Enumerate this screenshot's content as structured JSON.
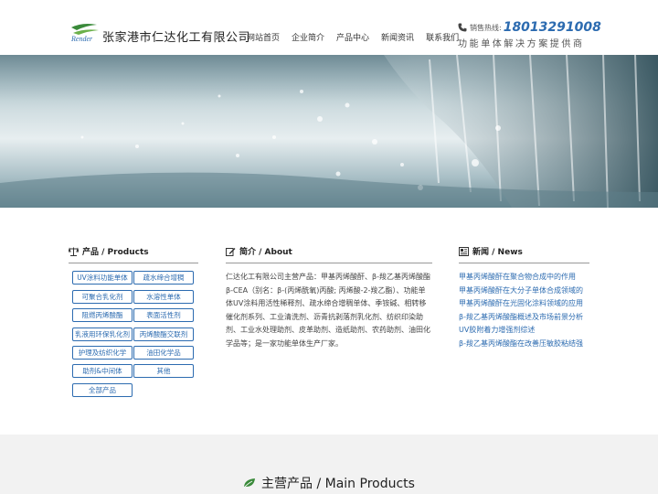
{
  "header": {
    "logo_text": "Render",
    "company_name": "张家港市仁达化工有限公司",
    "nav": [
      "网站首页",
      "企业简介",
      "产品中心",
      "新闻资讯",
      "联系我们"
    ],
    "hotline_label": "销售热线:",
    "hotline_number": "18013291008",
    "slogan": "功能单体解决方案提供商"
  },
  "products": {
    "title": "产品 / Products",
    "items": [
      "UV涂料功能单体",
      "疏水缔合增稠",
      "可聚合乳化剂",
      "水溶性单体",
      "阻燃丙烯酸酯",
      "表面活性剂",
      "乳液用环保乳化剂",
      "丙烯酸酯交联剂",
      "护理及纺织化学",
      "油田化学品",
      "助剂&中间体",
      "其他",
      "全部产品"
    ]
  },
  "about": {
    "title": "简介 / About",
    "text": "仁达化工有限公司主营产品：甲基丙烯酸酐、β-羧乙基丙烯酸酯β-CEA（别名：β-(丙烯酰氧)丙酸; 丙烯酸-2-羧乙酯）、功能单体UV涂料用活性稀释剂、疏水缔合增稠单体、季铵碱、相转移催化剂系列、工业清洗剂、沥青抗剥落剂乳化剂、纺织印染助剂、工业水处理助剂、皮革助剂、造纸助剂、农药助剂、油田化学品等；是一家功能单体生产厂家。"
  },
  "news": {
    "title": "新闻 / News",
    "items": [
      "甲基丙烯酸酐在聚合物合成中的作用",
      "甲基丙烯酸酐在大分子单体合成领域的",
      "甲基丙烯酸酐在光固化涂料领域的应用",
      "β-羧乙基丙烯酸酯概述及市场前景分析",
      "UV胶附着力增强剂综述",
      "β-羧乙基丙烯酸酯在改善压敏胶粘结强"
    ]
  },
  "main_products": {
    "title": "主营产品 / Main Products"
  },
  "colors": {
    "accent_blue": "#2c6bb0",
    "logo_green": "#3a8a3a",
    "band_gray": "#f2f2f2"
  }
}
